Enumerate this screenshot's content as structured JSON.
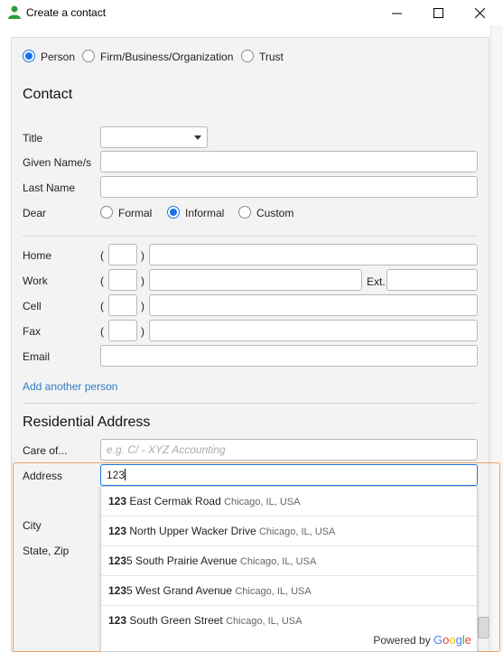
{
  "window": {
    "title": "Create a contact",
    "minimize_glyph": "—",
    "maximize_glyph": "☐",
    "close_glyph": "✕"
  },
  "entity_type": {
    "options": [
      "Person",
      "Firm/Business/Organization",
      "Trust"
    ],
    "selected": "Person"
  },
  "contact": {
    "heading": "Contact",
    "title_label": "Title",
    "given_label": "Given Name/s",
    "last_label": "Last Name",
    "dear_label": "Dear",
    "dear_options": [
      "Formal",
      "Informal",
      "Custom"
    ],
    "dear_selected": "Informal"
  },
  "phones": {
    "home_label": "Home",
    "work_label": "Work",
    "cell_label": "Cell",
    "fax_label": "Fax",
    "email_label": "Email",
    "ext_label": "Ext.",
    "open_paren": "(",
    "close_paren": ")"
  },
  "add_person_link": "Add another person",
  "address": {
    "heading": "Residential Address",
    "care_of_label": "Care of...",
    "care_of_placeholder": "e.g. C/ - XYZ Accounting",
    "address_label": "Address",
    "address_value": "123",
    "city_label": "City",
    "state_zip_label": "State, Zip"
  },
  "suggestions": [
    {
      "bold": "123",
      "rest": " East Cermak Road",
      "loc": "Chicago, IL, USA"
    },
    {
      "bold": "123",
      "rest": " North Upper Wacker Drive",
      "loc": "Chicago, IL, USA"
    },
    {
      "bold": "123",
      "rest": "5 South Prairie Avenue",
      "loc": "Chicago, IL, USA"
    },
    {
      "bold": "123",
      "rest": "5 West Grand Avenue",
      "loc": "Chicago, IL, USA"
    },
    {
      "bold": "123",
      "rest": " South Green Street",
      "loc": "Chicago, IL, USA"
    }
  ],
  "powered_by": {
    "prefix": "Powered by",
    "g1": "G",
    "g2": "o",
    "g3": "o",
    "g4": "g",
    "g5": "l",
    "g6": "e"
  },
  "colors": {
    "accent": "#1a73e8",
    "highlight_border": "#f0a060",
    "link": "#2f7cc8"
  },
  "icons": [
    "person-icon",
    "dropdown-arrow-icon",
    "minimize-icon",
    "maximize-icon",
    "close-icon"
  ]
}
